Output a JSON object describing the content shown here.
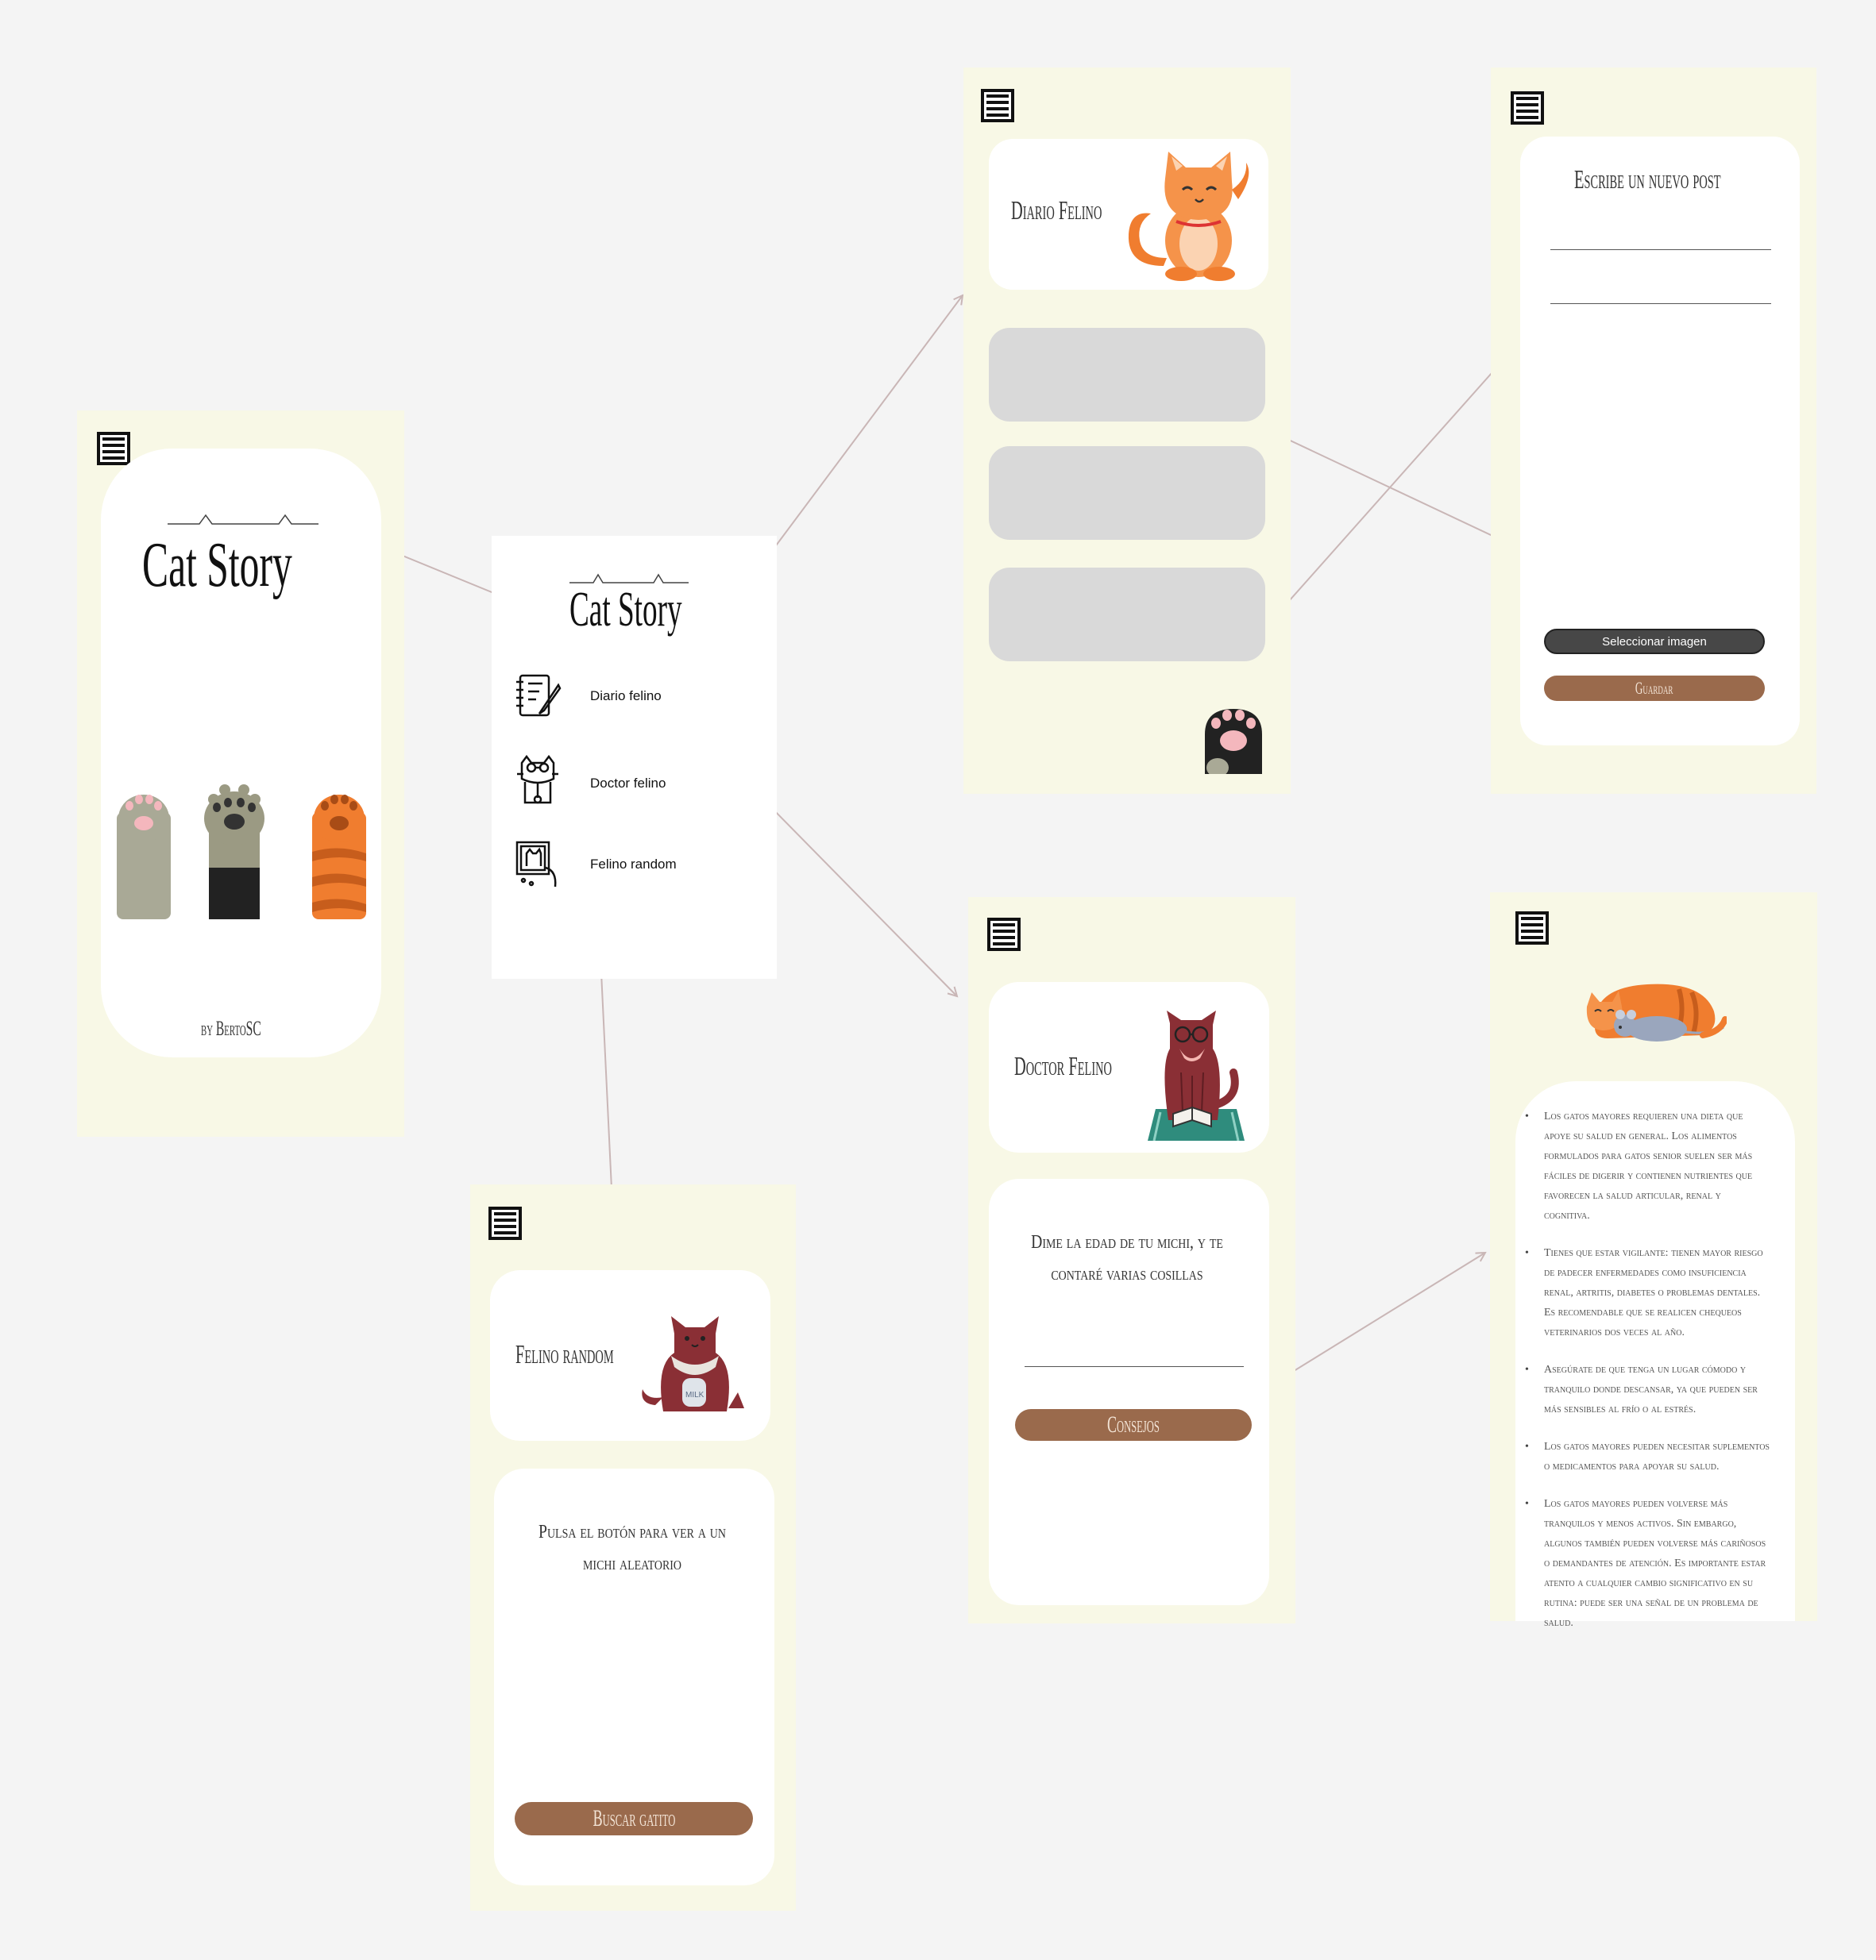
{
  "colors": {
    "canvas": "#f4f4f4",
    "screen_bg": "#f8f8e6",
    "card_bg": "#ffffff",
    "placeholder_gray": "#d9d9d9",
    "brown_button": "#9a6a4c",
    "dark_button": "#474747",
    "arrow": "#c9b6b6"
  },
  "splash": {
    "title": "Cat Story",
    "byline": "by BertoSC",
    "menu_icon": "hamburger-menu-icon",
    "paws": [
      "gray-paw-icon",
      "dark-paw-icon",
      "orange-paw-icon"
    ]
  },
  "nav_menu": {
    "title": "Cat Story",
    "items": [
      {
        "label": "Diario felino",
        "icon": "notebook-icon"
      },
      {
        "label": "Doctor felino",
        "icon": "doctor-cat-icon"
      },
      {
        "label": "Felino random",
        "icon": "cat-picture-icon"
      }
    ]
  },
  "diario": {
    "title": "Diario Felino",
    "illustration": "orange-cat-illustration",
    "post_count_visible": 3,
    "fab_icon": "paw-icon"
  },
  "new_post": {
    "title": "Escribe un nuevo post",
    "select_image_label": "Seleccionar imagen",
    "save_label": "Guardar"
  },
  "random": {
    "title": "Felino random",
    "illustration": "cat-with-milk-illustration",
    "prompt": "Pulsa el botón para ver a un michi aleatorio",
    "button_label": "Buscar gatito"
  },
  "doctor": {
    "title": "Doctor Felino",
    "illustration": "reading-cat-illustration",
    "prompt": "Dime la edad de tu michi, y te contaré varias cosillas",
    "button_label": "Consejos"
  },
  "advice": {
    "illustration": "sleeping-cats-illustration",
    "tips": [
      "Los gatos mayores requieren una dieta que apoye su salud en general. Los alimentos formulados para gatos senior suelen ser más fáciles de digerir y contienen nutrientes que favorecen la salud articular, renal y cognitiva.",
      "Tienes que estar vigilante: tienen mayor riesgo de padecer enfermedades como insuficiencia renal, artritis, diabetes o problemas dentales. Es recomendable que se realicen chequeos veterinarios dos veces al año.",
      "Asegúrate de que tenga un lugar cómodo y tranquilo donde descansar, ya que pueden ser más sensibles al frío o al estrés.",
      "Los gatos mayores pueden necesitar suplementos o medicamentos para apoyar su salud.",
      "Los gatos mayores pueden volverse más tranquilos y menos activos. Sin embargo, algunos también pueden volverse más cariñosos o demandantes de atención. Es importante estar atento a cualquier cambio significativo en su rutina: puede ser una señal de un problema de salud."
    ]
  }
}
